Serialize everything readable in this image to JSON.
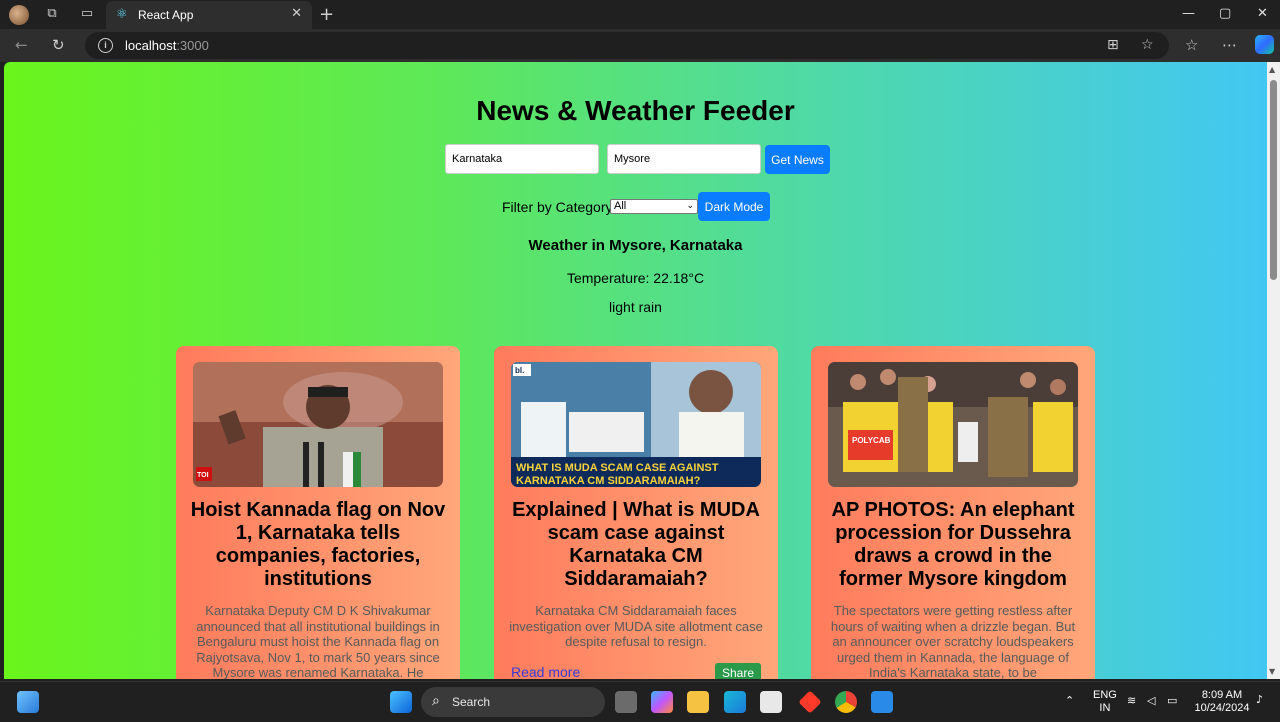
{
  "browser": {
    "tab_title": "React App",
    "url_host": "localhost",
    "url_port": ":3000",
    "tab_favicon": "react-icon"
  },
  "app": {
    "title": "News & Weather Feeder",
    "state_input": "Karnataka",
    "city_input": "Mysore",
    "get_news_label": "Get News",
    "filter_label": "Filter by Category:",
    "filter_selected": "All",
    "dark_mode_label": "Dark Mode"
  },
  "weather": {
    "title": "Weather in Mysore, Karnataka",
    "temperature": "Temperature: 22.18°C",
    "description": "light rain"
  },
  "articles": [
    {
      "title": "Hoist Kannada flag on Nov 1, Karnataka tells companies, factories, institutions",
      "description": "Karnataka Deputy CM D K Shivakumar announced that all institutional buildings in Bengaluru must hoist the Kannada flag on Rajyotsava, Nov 1, to mark 50 years since Mysore was renamed Karnataka. He",
      "image_badge": "TOI"
    },
    {
      "title": "Explained | What is MUDA scam case against Karnataka CM Siddaramaiah?",
      "description": "Karnataka CM Siddaramaiah faces investigation over MUDA site allotment case despite refusal to resign.",
      "read_more": "Read more",
      "share": "Share",
      "image_logo": "bl.",
      "image_caption_1": "WHAT IS MUDA SCAM CASE AGAINST",
      "image_caption_2": "KARNATAKA CM SIDDARAMAIAH?"
    },
    {
      "title": "AP PHOTOS: An elephant procession for Dussehra draws a crowd in the former Mysore kingdom",
      "description": "The spectators were getting restless after hours of waiting when a drizzle began. But an announcer over scratchy loudspeakers urged them in Kannada, the language of India's Karnataka state, to be",
      "image_banner": "POLYCAB"
    }
  ],
  "taskbar": {
    "search_label": "Search",
    "lang_1": "ENG",
    "lang_2": "IN",
    "time": "8:09 AM",
    "date": "10/24/2024"
  },
  "colors": {
    "accent_button": "#0a7cff",
    "share_button": "#2a9a4a",
    "card_gradient_start": "#ff7b5c",
    "card_gradient_end": "#ffa77a"
  }
}
